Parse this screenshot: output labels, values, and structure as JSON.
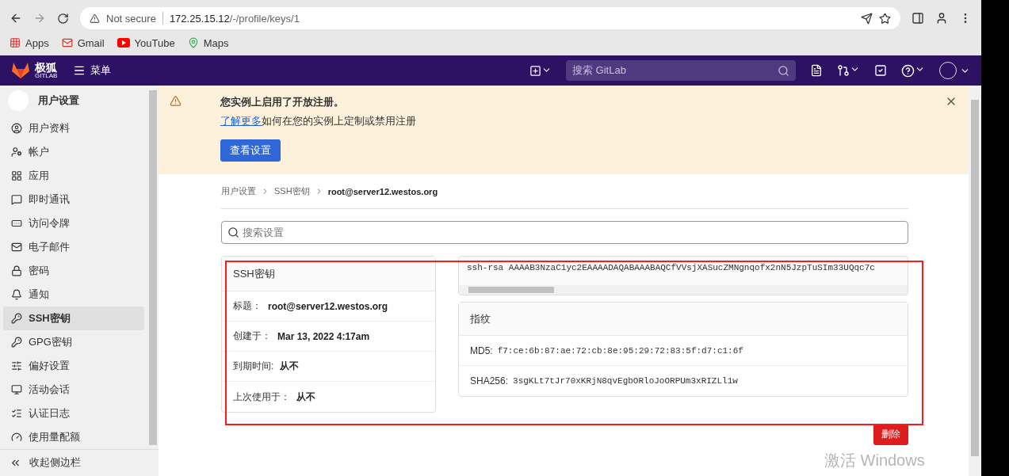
{
  "browser": {
    "not_secure": "Not secure",
    "host": "172.25.15.12",
    "path": "/-/profile/keys/1",
    "bookmarks": [
      {
        "kind": "apps",
        "label": "Apps"
      },
      {
        "kind": "gmail",
        "label": "Gmail"
      },
      {
        "kind": "youtube",
        "label": "YouTube"
      },
      {
        "kind": "maps",
        "label": "Maps"
      }
    ]
  },
  "navbar": {
    "logo": "极狐",
    "logo_sub": "GITLAB",
    "menu": "菜单",
    "search_placeholder": "搜索 GitLab"
  },
  "sidebar": {
    "title": "用户设置",
    "items": [
      {
        "label": "用户资料",
        "selected": false
      },
      {
        "label": "帐户",
        "selected": false
      },
      {
        "label": "应用",
        "selected": false
      },
      {
        "label": "即时通讯",
        "selected": false
      },
      {
        "label": "访问令牌",
        "selected": false
      },
      {
        "label": "电子邮件",
        "selected": false
      },
      {
        "label": "密码",
        "selected": false
      },
      {
        "label": "通知",
        "selected": false
      },
      {
        "label": "SSH密钥",
        "selected": true
      },
      {
        "label": "GPG密钥",
        "selected": false
      },
      {
        "label": "偏好设置",
        "selected": false
      },
      {
        "label": "活动会话",
        "selected": false
      },
      {
        "label": "认证日志",
        "selected": false
      },
      {
        "label": "使用量配额",
        "selected": false
      }
    ],
    "collapse": "收起侧边栏"
  },
  "banner": {
    "title": "您实例上启用了开放注册。",
    "link": "了解更多",
    "text": "如何在您的实例上定制或禁用注册",
    "button": "查看设置"
  },
  "breadcrumb": [
    "用户设置",
    "SSH密钥",
    "root@server12.westos.org"
  ],
  "search": {
    "placeholder": "搜索设置"
  },
  "key_card": {
    "title": "SSH密钥",
    "rows": [
      {
        "label": "标题：",
        "value": "root@server12.westos.org"
      },
      {
        "label": "创建于：",
        "value": "Mar 13, 2022 4:17am"
      },
      {
        "label": "到期时间:",
        "value": "从不"
      },
      {
        "label": "上次使用于：",
        "value": "从不"
      }
    ]
  },
  "key_text": "ssh-rsa AAAAB3NzaC1yc2EAAAADAQABAAABAQCfVVsjXASucZMNgnqofx2nN5JzpTuSIm33UQqc7c",
  "fingerprints": {
    "title": "指纹",
    "rows": [
      {
        "label": "MD5:",
        "value": "f7:ce:6b:87:ae:72:cb:8e:95:29:72:83:5f:d7:c1:6f"
      },
      {
        "label": "SHA256:",
        "value": "3sgKLt7tJr70xKRjN8qvEgbORloJoORPUm3xRIZLl1w"
      }
    ]
  },
  "delete_button": "删除",
  "annotation": {
    "kind": "frame"
  },
  "os_notice": "激活 Windows"
}
